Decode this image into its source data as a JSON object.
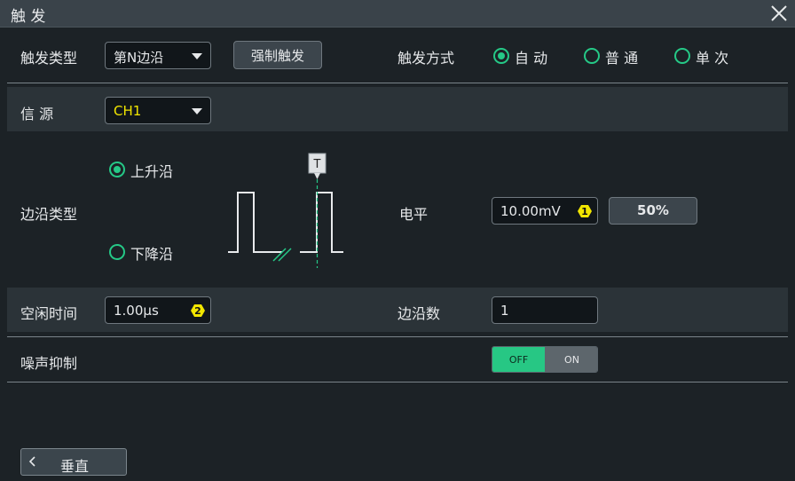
{
  "window": {
    "title": "触 发",
    "close_icon": "close-icon"
  },
  "trigger_type": {
    "label": "触发类型",
    "value": "第N边沿"
  },
  "force_trigger": {
    "label": "强制触发"
  },
  "trigger_mode": {
    "label": "触发方式",
    "options": [
      {
        "label": "自 动",
        "selected": true
      },
      {
        "label": "普 通",
        "selected": false
      },
      {
        "label": "单 次",
        "selected": false
      }
    ]
  },
  "source": {
    "label": "信 源",
    "value": "CH1",
    "color": "#f2e600"
  },
  "edge_type": {
    "label": "边沿类型",
    "options": [
      {
        "label": "上升沿",
        "selected": true
      },
      {
        "label": "下降沿",
        "selected": false
      }
    ],
    "marker_label": "T"
  },
  "level": {
    "label": "电平",
    "value": "10.00mV",
    "knob": "1",
    "percent_button": "50%"
  },
  "idle_time": {
    "label": "空闲时间",
    "value": "1.00μs",
    "knob": "2"
  },
  "edge_count": {
    "label": "边沿数",
    "value": "1"
  },
  "noise_reject": {
    "label": "噪声抑制",
    "off_label": "OFF",
    "on_label": "ON",
    "state": "OFF"
  },
  "footer": {
    "back_label": "垂直"
  },
  "colors": {
    "accent": "#25c987",
    "knob": "#f2e600",
    "panel": "#2b3338",
    "background": "#1c2226"
  }
}
